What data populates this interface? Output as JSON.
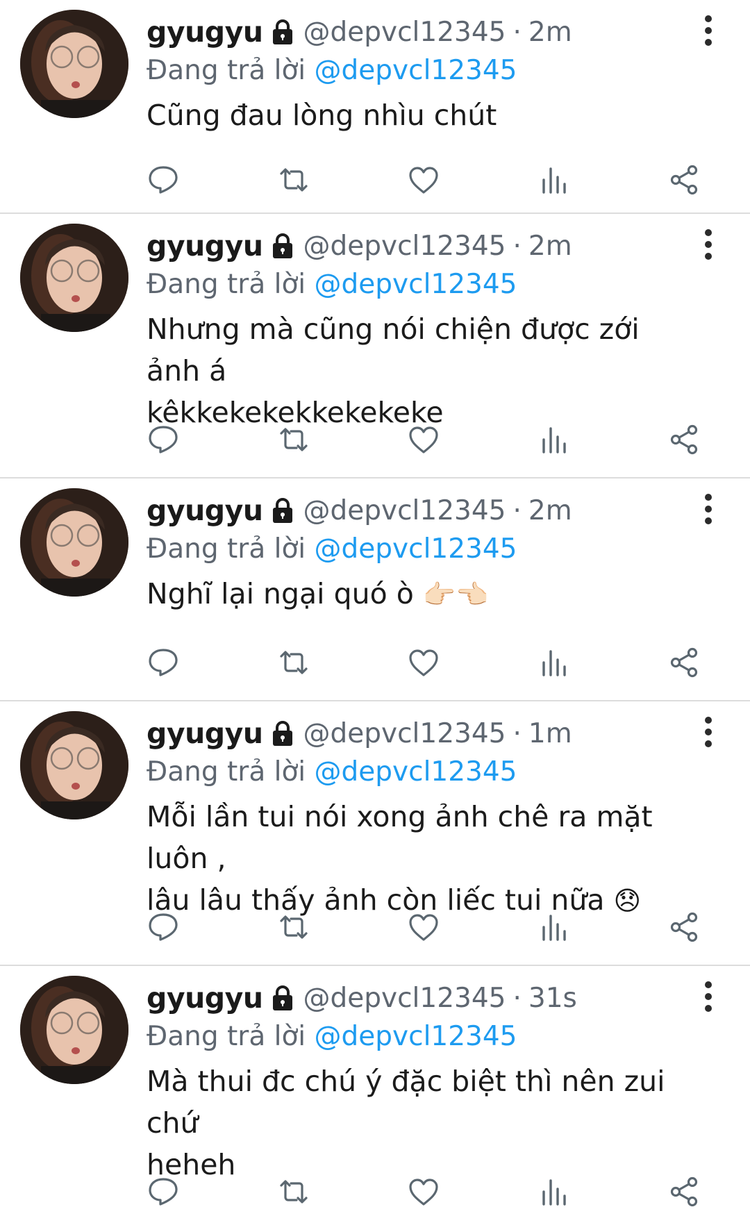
{
  "colors": {
    "accent": "#1d9bf0",
    "meta_text": "#5e6670",
    "divider": "#dcdcdc",
    "icon": "#5b6770"
  },
  "tweets": [
    {
      "name": "gyugyu",
      "handle": "@depvcl12345",
      "sep": "·",
      "time": "2m",
      "reply_prefix": "Đang trả lời ",
      "reply_to": "@depvcl12345",
      "lines": [
        "Cũng đau lòng nhìu chút"
      ],
      "emoji": ""
    },
    {
      "name": "gyugyu",
      "handle": "@depvcl12345",
      "sep": "·",
      "time": "2m",
      "reply_prefix": "Đang trả lời ",
      "reply_to": "@depvcl12345",
      "lines": [
        "Nhưng mà cũng nói chiện được zới ảnh á",
        "kêkkekekekkekekeke"
      ],
      "emoji": ""
    },
    {
      "name": "gyugyu",
      "handle": "@depvcl12345",
      "sep": "·",
      "time": "2m",
      "reply_prefix": "Đang trả lời ",
      "reply_to": "@depvcl12345",
      "lines": [
        "Nghĩ lại ngại quó ò "
      ],
      "emoji": "👉🏻👈🏻"
    },
    {
      "name": "gyugyu",
      "handle": "@depvcl12345",
      "sep": "·",
      "time": "1m",
      "reply_prefix": "Đang trả lời ",
      "reply_to": "@depvcl12345",
      "lines": [
        "Mỗi lần tui nói xong ảnh chê ra mặt luôn ,",
        "lâu lâu thấy ảnh còn liếc tui nữa "
      ],
      "emoji": "😞"
    },
    {
      "name": "gyugyu",
      "handle": "@depvcl12345",
      "sep": "·",
      "time": "31s",
      "reply_prefix": "Đang trả lời ",
      "reply_to": "@depvcl12345",
      "lines": [
        "Mà thui đc chú ý đặc biệt thì nên zui chứ",
        "heheh"
      ],
      "emoji": ""
    }
  ],
  "icons": {
    "more": "more-vertical-icon",
    "lock": "lock-icon",
    "reply": "reply-icon",
    "retweet": "retweet-icon",
    "like": "like-icon",
    "views": "views-icon",
    "share": "share-icon"
  }
}
